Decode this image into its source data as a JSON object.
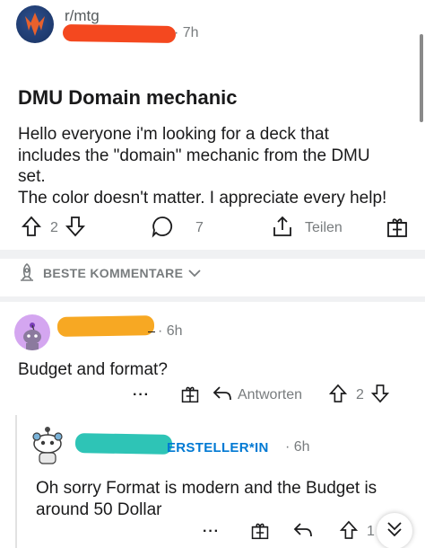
{
  "post": {
    "subreddit": "r/mtg",
    "time_fragment": "· 7h",
    "title": "DMU Domain mechanic",
    "body_lines": [
      "Hello everyone i'm looking for a deck that",
      "includes the \"domain\" mechanic from the DMU",
      "set.",
      "The color doesn't matter. I appreciate every help!"
    ],
    "upvotes": "2",
    "comments": "7",
    "share_label": "Teilen"
  },
  "sort": {
    "label": "BESTE KOMMENTARE"
  },
  "comments": [
    {
      "time": "· 6h",
      "text": "Budget and format?",
      "more": "···",
      "reply_label": "Antworten",
      "votes": "2"
    },
    {
      "op_flair": "ERSTELLER*IN",
      "time": "· 6h",
      "text_lines": [
        "Oh sorry Format is modern and the Budget is",
        "around 50 Dollar"
      ],
      "more": "···",
      "votes": "1"
    }
  ],
  "colors": {
    "accent": "#0079d3",
    "redaction_post": "#f4481f",
    "redaction_comment1": "#f7a823",
    "redaction_comment2": "#2ec4b6"
  }
}
